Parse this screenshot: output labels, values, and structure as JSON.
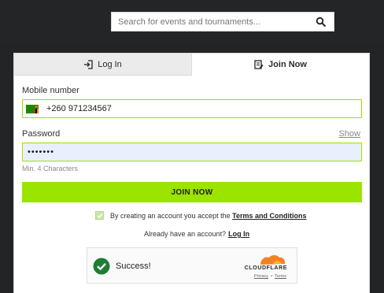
{
  "header": {
    "search_placeholder": "Search for events and tournaments...",
    "search_icon": "search-icon"
  },
  "tabs": [
    {
      "label": "Log In",
      "icon": "login-icon",
      "active": false
    },
    {
      "label": "Join Now",
      "icon": "join-icon",
      "active": true
    }
  ],
  "form": {
    "mobile_label": "Mobile number",
    "mobile_value": "+260 971234567",
    "flag_icon": "zambia-flag-icon",
    "password_label": "Password",
    "password_value": "•••••••",
    "show_label": "Show",
    "hint": "Min. 4 Characters",
    "submit_label": "JOIN NOW",
    "terms_prefix": "By creating an account you accept the",
    "terms_link": "Terms and Conditions",
    "already_prefix": "Already have an account?",
    "already_link": "Log In"
  },
  "captcha": {
    "status": "Success!",
    "brand": "CLOUDFLARE",
    "privacy": "Privacy",
    "separator": "•",
    "terms": "Terms"
  },
  "colors": {
    "accent": "#9be400",
    "header_bg": "#232526",
    "cloudflare_orange": "#f48120",
    "success_green": "#1e7e34"
  }
}
